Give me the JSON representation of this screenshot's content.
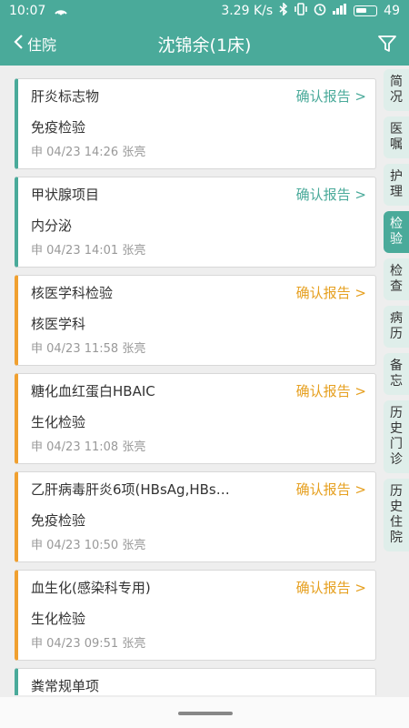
{
  "status": {
    "time": "10:07",
    "speed": "3.29 K/s",
    "battery": "49"
  },
  "header": {
    "back_label": "住院",
    "title": "沈锦余(1床)"
  },
  "cards": [
    {
      "name": "肝炎标志物",
      "action": "确认报告 >",
      "dept": "免疫检验",
      "meta": "申 04/23 14:26 张亮",
      "accent": "teal"
    },
    {
      "name": "甲状腺项目",
      "action": "确认报告 >",
      "dept": "内分泌",
      "meta": "申 04/23 14:01 张亮",
      "accent": "teal"
    },
    {
      "name": "核医学科检验",
      "action": "确认报告 >",
      "dept": "核医学科",
      "meta": "申 04/23 11:58 张亮",
      "accent": "orange"
    },
    {
      "name": "糖化血红蛋白HBAIC",
      "action": "确认报告 >",
      "dept": "生化检验",
      "meta": "申 04/23 11:08 张亮",
      "accent": "orange"
    },
    {
      "name": "乙肝病毒肝炎6项(HBsAg,HBs…",
      "action": "确认报告 >",
      "dept": "免疫检验",
      "meta": "申 04/23 10:50 张亮",
      "accent": "orange"
    },
    {
      "name": "血生化(感染科专用)",
      "action": "确认报告 >",
      "dept": "生化检验",
      "meta": "申 04/23 09:51 张亮",
      "accent": "orange"
    },
    {
      "name": "粪常规单项",
      "accent": "teal"
    }
  ],
  "side_tabs": [
    "简况",
    "医嘱",
    "护理",
    "检验",
    "检查",
    "病历",
    "备忘",
    "历史门诊",
    "历史住院"
  ],
  "active_tab": "检验",
  "colors": {
    "accent": "#4aaa9a",
    "orange": "#f0a030",
    "tab_bg": "#dfeeea"
  }
}
